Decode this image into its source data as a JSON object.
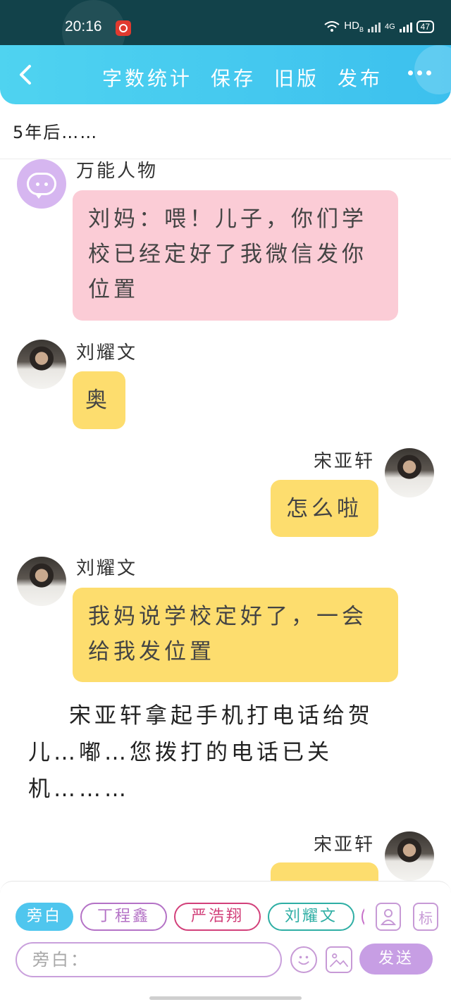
{
  "status_bar": {
    "time": "20:16",
    "network": "HD",
    "network_sub": "B",
    "signal_label": "4G",
    "battery": "47"
  },
  "header": {
    "actions": [
      "字数统计",
      "保存",
      "旧版",
      "发布"
    ]
  },
  "subtitle": "5年后……",
  "messages": [
    {
      "sender": "万能人物",
      "text": "刘妈：喂！儿子，你们学校已经定好了我微信发你位置",
      "avatar": "chat-bubble-icon",
      "color": "#fbccd6"
    },
    {
      "sender": "刘耀文",
      "text": "奥",
      "color": "#fddd6e"
    },
    {
      "sender": "宋亚轩",
      "text": "怎么啦",
      "color": "#fddd6e"
    },
    {
      "sender": "刘耀文",
      "text": "我妈说学校定好了，一会给我发位置",
      "color": "#fddd6e"
    },
    {
      "sender": "宋亚轩",
      "text": ""
    }
  ],
  "narration": "宋亚轩拿起手机打电话给贺儿…嘟…您拨打的电话已关机………",
  "input_panel": {
    "roles": [
      "旁白",
      "丁程鑫",
      "严浩翔",
      "刘耀文"
    ],
    "tool_label": "标",
    "placeholder": "旁白：",
    "send_label": "发送"
  }
}
